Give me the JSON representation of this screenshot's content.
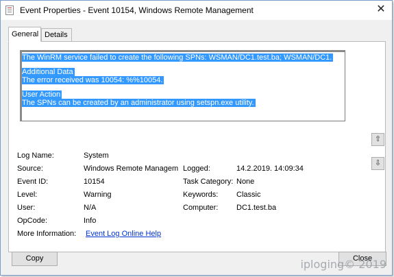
{
  "window": {
    "title": "Event Properties - Event 10154, Windows Remote Management",
    "close_glyph": "✕"
  },
  "tabs": [
    {
      "label": "General",
      "active": true
    },
    {
      "label": "Details",
      "active": false
    }
  ],
  "description": {
    "line1": "The WinRM service failed to create the following SPNs: WSMAN/DC1.test.ba; WSMAN/DC1.",
    "heading2": "Additional Data",
    "line2": "The error received was 10054: %%10054.",
    "heading3": "User Action",
    "line3": "The SPNs can be created by an administrator using setspn.exe utility."
  },
  "scroll_buttons": {
    "up": "⇧",
    "down": "⇩"
  },
  "fields": {
    "log_name": {
      "label": "Log Name:",
      "value": "System"
    },
    "source": {
      "label": "Source:",
      "value": "Windows Remote Managem"
    },
    "logged": {
      "label": "Logged:",
      "value": "14.2.2019. 14:09:34"
    },
    "event_id": {
      "label": "Event ID:",
      "value": "10154"
    },
    "task_category": {
      "label": "Task Category:",
      "value": "None"
    },
    "level": {
      "label": "Level:",
      "value": "Warning"
    },
    "keywords": {
      "label": "Keywords:",
      "value": "Classic"
    },
    "user": {
      "label": "User:",
      "value": "N/A"
    },
    "computer": {
      "label": "Computer:",
      "value": "DC1.test.ba"
    },
    "opcode": {
      "label": "OpCode:",
      "value": "Info"
    },
    "more_info": {
      "label": "More Information:",
      "link": "Event Log Online Help"
    }
  },
  "buttons": {
    "copy": "Copy",
    "close": "Close"
  },
  "watermark": "iploging© 2019"
}
